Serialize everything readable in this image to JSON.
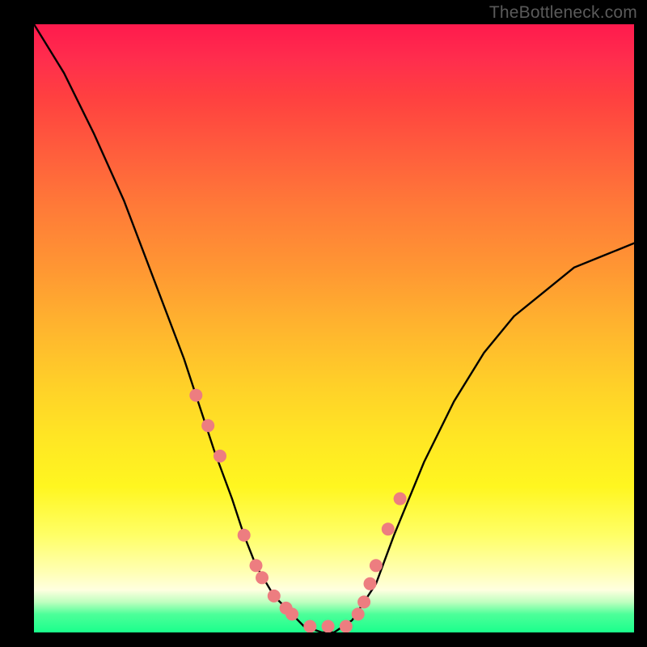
{
  "watermark": "TheBottleneck.com",
  "chart_data": {
    "type": "line",
    "title": "",
    "xlabel": "",
    "ylabel": "",
    "xlim": [
      0,
      100
    ],
    "ylim": [
      0,
      100
    ],
    "grid": false,
    "background_gradient": {
      "direction": "vertical",
      "stops": [
        {
          "pct": 0,
          "color": "#ff1a4d"
        },
        {
          "pct": 50,
          "color": "#ffd228"
        },
        {
          "pct": 93,
          "color": "#ffffe0"
        },
        {
          "pct": 100,
          "color": "#1aff8c"
        }
      ]
    },
    "series": [
      {
        "name": "bottleneck-curve",
        "color": "#000000",
        "x": [
          0,
          5,
          10,
          15,
          20,
          25,
          27,
          30,
          33,
          35,
          37,
          40,
          43,
          45,
          48,
          50,
          53,
          57,
          60,
          65,
          70,
          75,
          80,
          85,
          90,
          95,
          100
        ],
        "y": [
          100,
          92,
          82,
          71,
          58,
          45,
          39,
          30,
          22,
          16,
          11,
          6,
          3,
          1,
          0,
          0,
          2,
          8,
          16,
          28,
          38,
          46,
          52,
          56,
          60,
          62,
          64
        ]
      }
    ],
    "markers": {
      "name": "curve-dots",
      "color": "#ed7d80",
      "radius_px": 8,
      "x": [
        27,
        29,
        31,
        35,
        37,
        38,
        40,
        42,
        43,
        46,
        49,
        52,
        54,
        55,
        56,
        57,
        59,
        61
      ],
      "y": [
        39,
        34,
        29,
        16,
        11,
        9,
        6,
        4,
        3,
        1,
        1,
        1,
        3,
        5,
        8,
        11,
        17,
        22
      ]
    }
  }
}
